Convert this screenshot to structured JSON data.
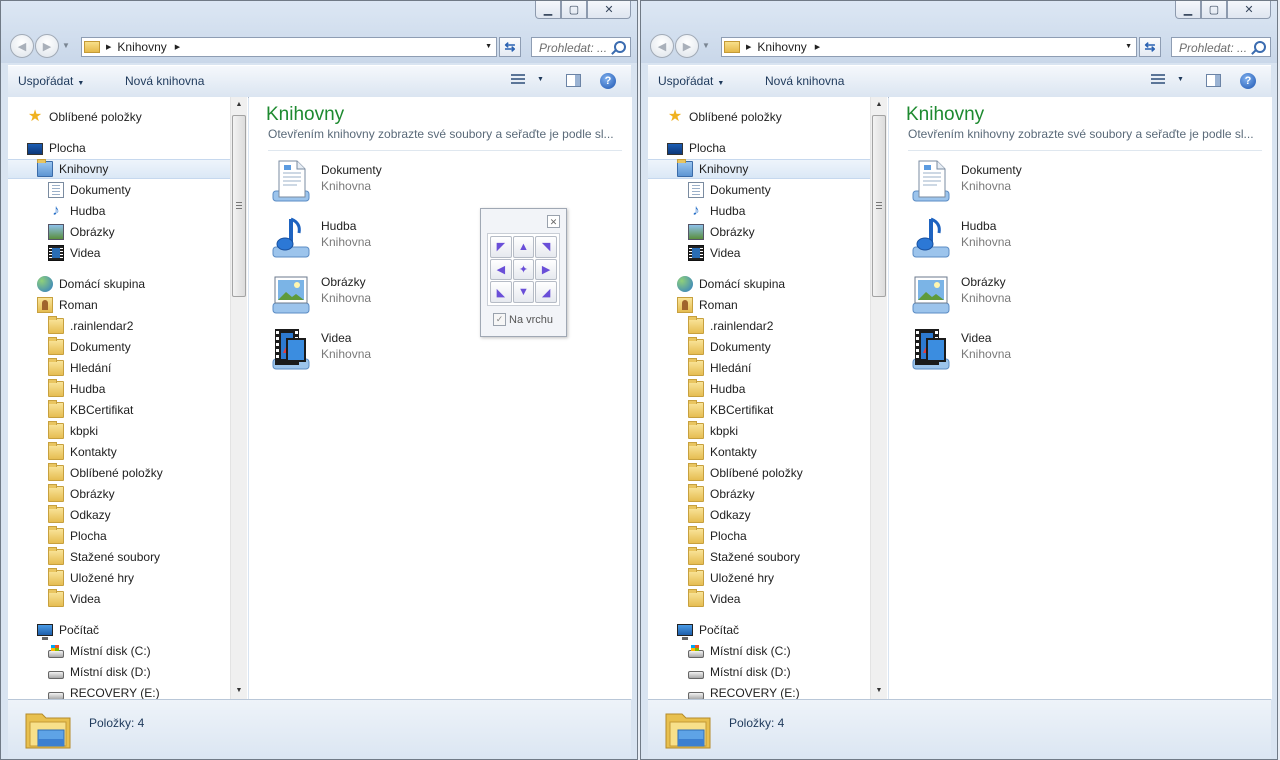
{
  "windows": [
    {
      "address": {
        "path": "Knihovny"
      },
      "search": {
        "placeholder": "Prohledat: ..."
      },
      "toolbar": {
        "organize": "Uspořádat",
        "new_library": "Nová knihovna"
      },
      "library": {
        "title": "Knihovny",
        "subtitle": "Otevřením knihovny zobrazte své soubory a seřaďte je podle sl...",
        "items": [
          {
            "name": "Dokumenty",
            "type": "Knihovna",
            "icon": "documents-library-icon"
          },
          {
            "name": "Hudba",
            "type": "Knihovna",
            "icon": "music-library-icon"
          },
          {
            "name": "Obrázky",
            "type": "Knihovna",
            "icon": "pictures-library-icon"
          },
          {
            "name": "Videa",
            "type": "Knihovna",
            "icon": "videos-library-icon"
          }
        ]
      },
      "nav": [
        {
          "label": "Oblíbené položky",
          "icon": "star"
        },
        {
          "label": "Plocha",
          "icon": "desktop"
        },
        {
          "label": "Knihovny",
          "icon": "libfolder",
          "selected": true
        },
        {
          "label": "Dokumenty",
          "icon": "doc"
        },
        {
          "label": "Hudba",
          "icon": "music"
        },
        {
          "label": "Obrázky",
          "icon": "pic"
        },
        {
          "label": "Videa",
          "icon": "video"
        },
        {
          "label": "Domácí skupina",
          "icon": "home"
        },
        {
          "label": "Roman",
          "icon": "user"
        },
        {
          "label": ".rainlendar2",
          "icon": "folder"
        },
        {
          "label": "Dokumenty",
          "icon": "folder"
        },
        {
          "label": "Hledání",
          "icon": "folder"
        },
        {
          "label": "Hudba",
          "icon": "folder"
        },
        {
          "label": "KBCertifikat",
          "icon": "folder"
        },
        {
          "label": "kbpki",
          "icon": "folder"
        },
        {
          "label": "Kontakty",
          "icon": "folder"
        },
        {
          "label": "Oblíbené položky",
          "icon": "folder"
        },
        {
          "label": "Obrázky",
          "icon": "folder"
        },
        {
          "label": "Odkazy",
          "icon": "folder"
        },
        {
          "label": "Plocha",
          "icon": "folder"
        },
        {
          "label": "Stažené soubory",
          "icon": "folder"
        },
        {
          "label": "Uložené hry",
          "icon": "folder"
        },
        {
          "label": "Videa",
          "icon": "folder"
        },
        {
          "label": "Počítač",
          "icon": "computer"
        },
        {
          "label": "Místní disk (C:)",
          "icon": "disksys"
        },
        {
          "label": "Místní disk (D:)",
          "icon": "disk"
        },
        {
          "label": "RECOVERY (E:)",
          "icon": "disk"
        }
      ],
      "status": {
        "text": "Položky: 4"
      }
    },
    {
      "address": {
        "path": "Knihovny"
      },
      "search": {
        "placeholder": "Prohledat: ..."
      },
      "toolbar": {
        "organize": "Uspořádat",
        "new_library": "Nová knihovna"
      },
      "library": {
        "title": "Knihovny",
        "subtitle": "Otevřením knihovny zobrazte své soubory a seřaďte je podle sl...",
        "items": [
          {
            "name": "Dokumenty",
            "type": "Knihovna",
            "icon": "documents-library-icon"
          },
          {
            "name": "Hudba",
            "type": "Knihovna",
            "icon": "music-library-icon"
          },
          {
            "name": "Obrázky",
            "type": "Knihovna",
            "icon": "pictures-library-icon"
          },
          {
            "name": "Videa",
            "type": "Knihovna",
            "icon": "videos-library-icon"
          }
        ]
      },
      "nav": [
        {
          "label": "Oblíbené položky",
          "icon": "star"
        },
        {
          "label": "Plocha",
          "icon": "desktop"
        },
        {
          "label": "Knihovny",
          "icon": "libfolder",
          "selected": true
        },
        {
          "label": "Dokumenty",
          "icon": "doc"
        },
        {
          "label": "Hudba",
          "icon": "music"
        },
        {
          "label": "Obrázky",
          "icon": "pic"
        },
        {
          "label": "Videa",
          "icon": "video"
        },
        {
          "label": "Domácí skupina",
          "icon": "home"
        },
        {
          "label": "Roman",
          "icon": "user"
        },
        {
          "label": ".rainlendar2",
          "icon": "folder"
        },
        {
          "label": "Dokumenty",
          "icon": "folder"
        },
        {
          "label": "Hledání",
          "icon": "folder"
        },
        {
          "label": "Hudba",
          "icon": "folder"
        },
        {
          "label": "KBCertifikat",
          "icon": "folder"
        },
        {
          "label": "kbpki",
          "icon": "folder"
        },
        {
          "label": "Kontakty",
          "icon": "folder"
        },
        {
          "label": "Oblíbené položky",
          "icon": "folder"
        },
        {
          "label": "Obrázky",
          "icon": "folder"
        },
        {
          "label": "Odkazy",
          "icon": "folder"
        },
        {
          "label": "Plocha",
          "icon": "folder"
        },
        {
          "label": "Stažené soubory",
          "icon": "folder"
        },
        {
          "label": "Uložené hry",
          "icon": "folder"
        },
        {
          "label": "Videa",
          "icon": "folder"
        },
        {
          "label": "Počítač",
          "icon": "computer"
        },
        {
          "label": "Místní disk (C:)",
          "icon": "disksys"
        },
        {
          "label": "Místní disk (D:)",
          "icon": "disk"
        },
        {
          "label": "RECOVERY (E:)",
          "icon": "disk"
        }
      ],
      "status": {
        "text": "Položky: 4"
      }
    }
  ],
  "mover": {
    "always_on_top_label": "Na vrchu",
    "always_on_top_checked": true,
    "buttons": [
      {
        "icon": "arrow-top-left-icon",
        "glyph": "◤"
      },
      {
        "icon": "arrow-up-icon",
        "glyph": "▲"
      },
      {
        "icon": "arrow-top-right-icon",
        "glyph": "◥"
      },
      {
        "icon": "arrow-left-icon",
        "glyph": "◀"
      },
      {
        "icon": "center-icon",
        "glyph": "✦"
      },
      {
        "icon": "arrow-right-icon",
        "glyph": "▶"
      },
      {
        "icon": "arrow-bottom-left-icon",
        "glyph": "◣"
      },
      {
        "icon": "arrow-down-icon",
        "glyph": "▼"
      },
      {
        "icon": "arrow-bottom-right-icon",
        "glyph": "◢"
      }
    ]
  }
}
